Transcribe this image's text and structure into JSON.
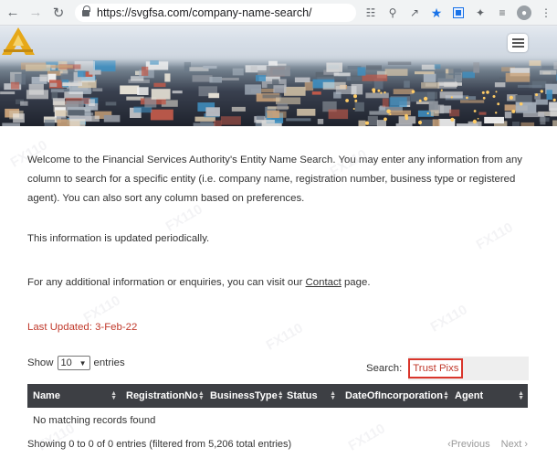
{
  "browser": {
    "url": "https://svgfsa.com/company-name-search/"
  },
  "page": {
    "intro": "Welcome to the Financial Services Authority's Entity Name Search. You may enter any information from any column to search for a specific entity (i.e. company name, registration number, business type or registered agent). You can also sort any column based on preferences.",
    "updated_notice": "This information is updated periodically.",
    "contact_prefix": "For any additional information or enquiries, you can visit our ",
    "contact_link": "Contact",
    "contact_suffix": " page.",
    "last_updated": "Last Updated:  3-Feb-22",
    "show_label": "Show",
    "show_value": "10",
    "entries_label": "entries",
    "search_label": "Search:",
    "search_value": "Trust Pixs",
    "no_records": "No matching records found",
    "showing_info": "Showing 0 to 0 of 0 entries (filtered from 5,206 total entries)",
    "previous_label": "Previous",
    "next_label": "Next"
  },
  "table": {
    "columns": [
      "Name",
      "RegistrationNo",
      "BusinessType",
      "Status",
      "DateOfIncorporation",
      "Agent"
    ]
  },
  "colors": {
    "table_header_bg": "#3d3f44",
    "accent_red": "#c0392b",
    "search_border": "#d9352b"
  }
}
